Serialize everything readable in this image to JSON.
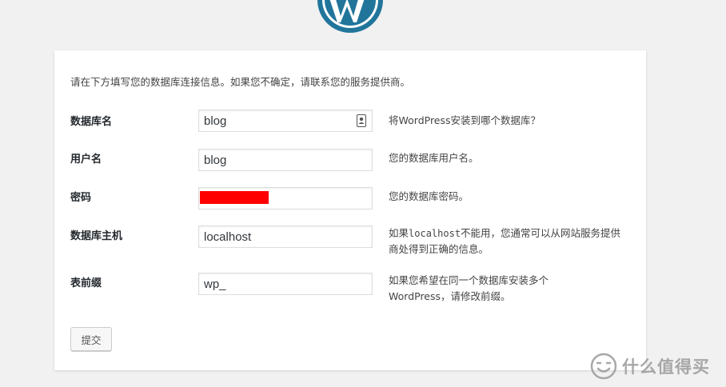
{
  "header": {
    "logo_icon": "wordpress-logo-icon",
    "logo_color": "#21759b"
  },
  "form": {
    "intro": "请在下方填写您的数据库连接信息。如果您不确定，请联系您的服务提供商。",
    "fields": [
      {
        "label": "数据库名",
        "value": "blog",
        "description": "将WordPress安装到哪个数据库？",
        "icon": "contact-card-icon"
      },
      {
        "label": "用户名",
        "value": "blog",
        "description": "您的数据库用户名。"
      },
      {
        "label": "密码",
        "value": "",
        "description": "您的数据库密码。",
        "redaction_color": "#ff0000"
      },
      {
        "label": "数据库主机",
        "value": "localhost",
        "description_prefix": "如果",
        "description_code": "localhost",
        "description_suffix": "不能用，您通常可以从网站服务提供商处得到正确的信息。"
      },
      {
        "label": "表前缀",
        "value": "wp_",
        "description": "如果您希望在同一个数据库安装多个WordPress，请修改前缀。"
      }
    ],
    "submit_label": "提交"
  },
  "watermark": {
    "text": "什么值得买",
    "icon": "smzdm-logo-icon"
  }
}
